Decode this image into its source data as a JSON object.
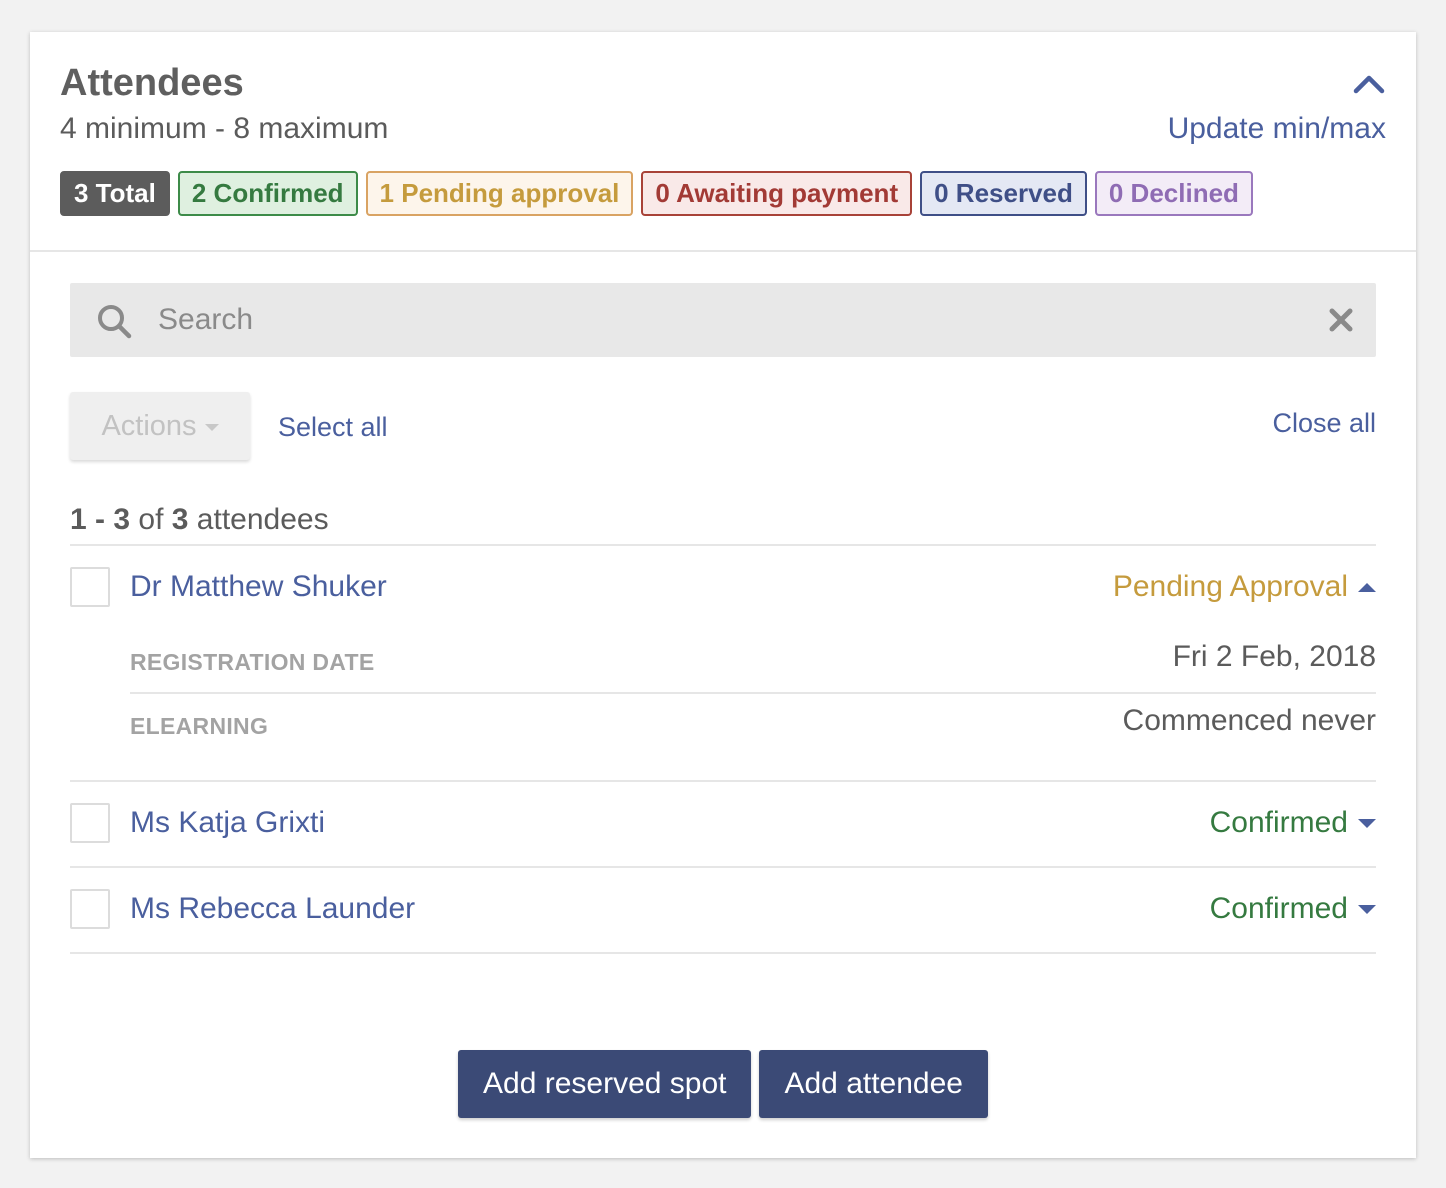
{
  "panel": {
    "title": "Attendees",
    "subtitle": "4 minimum - 8 maximum",
    "update_link": "Update min/max"
  },
  "badges": [
    {
      "label": "3 Total",
      "color": "#5c5c5c"
    },
    {
      "label": "2 Confirmed",
      "color": "#357a40"
    },
    {
      "label": "1 Pending approval",
      "color": "#c59b3d"
    },
    {
      "label": "0 Awaiting payment",
      "color": "#a23a35"
    },
    {
      "label": "0 Reserved",
      "color": "#3f4f87"
    },
    {
      "label": "0 Declined",
      "color": "#8f6cb4"
    }
  ],
  "search": {
    "placeholder": "Search"
  },
  "toolbar": {
    "actions_label": "Actions",
    "select_all": "Select all",
    "close_all": "Close all"
  },
  "count": {
    "start": "1",
    "end": "3",
    "total": "3",
    "of": "of",
    "suffix": "attendees"
  },
  "attendees": [
    {
      "name": "Dr Matthew Shuker",
      "status": "Pending Approval",
      "expanded": true,
      "details": [
        {
          "label": "REGISTRATION DATE",
          "value": "Fri 2 Feb, 2018"
        },
        {
          "label": "ELEARNING",
          "value": "Commenced never"
        }
      ]
    },
    {
      "name": "Ms Katja Grixti",
      "status": "Confirmed",
      "expanded": false
    },
    {
      "name": "Ms Rebecca Launder",
      "status": "Confirmed",
      "expanded": false
    }
  ],
  "buttons": {
    "add_reserved": "Add reserved spot",
    "add_attendee": "Add attendee"
  },
  "colors": {
    "link": "#4a5f9e",
    "primary_button": "#3b4a76",
    "pending": "#c59b3d",
    "confirmed": "#357a40"
  }
}
